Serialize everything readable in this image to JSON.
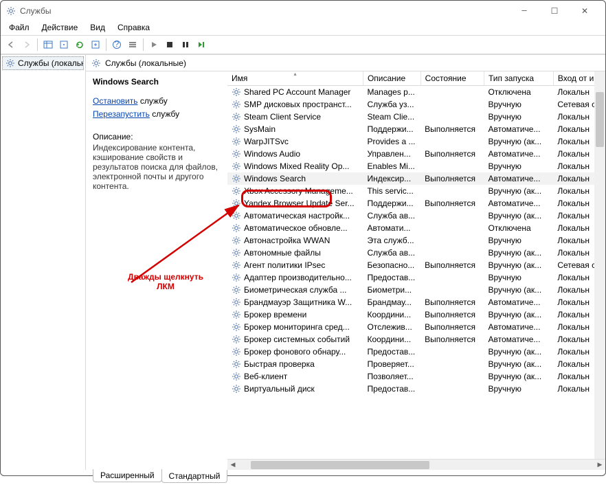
{
  "window": {
    "title": "Службы"
  },
  "menu": {
    "file": "Файл",
    "action": "Действие",
    "view": "Вид",
    "help": "Справка"
  },
  "tree": {
    "root": "Службы (локальн"
  },
  "main_head": "Службы (локальные)",
  "desc": {
    "name": "Windows Search",
    "stop_prefix": "Остановить",
    "stop_suffix": " службу",
    "restart_prefix": "Перезапустить",
    "restart_suffix": " службу",
    "heading": "Описание:",
    "text": "Индексирование контента, кэширование свойств и результатов поиска для файлов, электронной почты и другого контента."
  },
  "cols": {
    "name": "Имя",
    "desc": "Описание",
    "state": "Состояние",
    "start": "Тип запуска",
    "logon": "Вход от и"
  },
  "rows": [
    {
      "n": "Shared PC Account Manager",
      "d": "Manages p...",
      "s": "",
      "t": "Отключена",
      "l": "Локальн"
    },
    {
      "n": "SMP дисковых пространст...",
      "d": "Служба уз...",
      "s": "",
      "t": "Вручную",
      "l": "Сетевая с"
    },
    {
      "n": "Steam Client Service",
      "d": "Steam Clie...",
      "s": "",
      "t": "Вручную",
      "l": "Локальн"
    },
    {
      "n": "SysMain",
      "d": "Поддержи...",
      "s": "Выполняется",
      "t": "Автоматиче...",
      "l": "Локальн"
    },
    {
      "n": "WarpJITSvc",
      "d": "Provides a ...",
      "s": "",
      "t": "Вручную (ак...",
      "l": "Локальн"
    },
    {
      "n": "Windows Audio",
      "d": "Управлен...",
      "s": "Выполняется",
      "t": "Автоматиче...",
      "l": "Локальн"
    },
    {
      "n": "Windows Mixed Reality Op...",
      "d": "Enables Mi...",
      "s": "",
      "t": "Вручную",
      "l": "Локальн"
    },
    {
      "n": "Windows Search",
      "d": "Индексир...",
      "s": "Выполняется",
      "t": "Автоматиче...",
      "l": "Локальн",
      "sel": true
    },
    {
      "n": "Xbox Accessory Manageme...",
      "d": "This servic...",
      "s": "",
      "t": "Вручную (ак...",
      "l": "Локальн"
    },
    {
      "n": "Yandex.Browser Update Ser...",
      "d": "Поддержи...",
      "s": "Выполняется",
      "t": "Автоматиче...",
      "l": "Локальн"
    },
    {
      "n": "Автоматическая настройк...",
      "d": "Служба ав...",
      "s": "",
      "t": "Вручную (ак...",
      "l": "Локальн"
    },
    {
      "n": "Автоматическое обновле...",
      "d": "Автомати...",
      "s": "",
      "t": "Отключена",
      "l": "Локальн"
    },
    {
      "n": "Автонастройка WWAN",
      "d": "Эта служб...",
      "s": "",
      "t": "Вручную",
      "l": "Локальн"
    },
    {
      "n": "Автономные файлы",
      "d": "Служба ав...",
      "s": "",
      "t": "Вручную (ак...",
      "l": "Локальн"
    },
    {
      "n": "Агент политики IPsec",
      "d": "Безопасно...",
      "s": "Выполняется",
      "t": "Вручную (ак...",
      "l": "Сетевая с"
    },
    {
      "n": "Адаптер производительно...",
      "d": "Предостав...",
      "s": "",
      "t": "Вручную",
      "l": "Локальн"
    },
    {
      "n": "Биометрическая служба ...",
      "d": "Биометри...",
      "s": "",
      "t": "Вручную (ак...",
      "l": "Локальн"
    },
    {
      "n": "Брандмауэр Защитника W...",
      "d": "Брандмау...",
      "s": "Выполняется",
      "t": "Автоматиче...",
      "l": "Локальн"
    },
    {
      "n": "Брокер времени",
      "d": "Координи...",
      "s": "Выполняется",
      "t": "Вручную (ак...",
      "l": "Локальн"
    },
    {
      "n": "Брокер мониторинга сред...",
      "d": "Отслежив...",
      "s": "Выполняется",
      "t": "Автоматиче...",
      "l": "Локальн"
    },
    {
      "n": "Брокер системных событий",
      "d": "Координи...",
      "s": "Выполняется",
      "t": "Автоматиче...",
      "l": "Локальн"
    },
    {
      "n": "Брокер фонового обнару...",
      "d": "Предостав...",
      "s": "",
      "t": "Вручную (ак...",
      "l": "Локальн"
    },
    {
      "n": "Быстрая проверка",
      "d": "Проверяет...",
      "s": "",
      "t": "Вручную (ак...",
      "l": "Локальн"
    },
    {
      "n": "Веб-клиент",
      "d": "Позволяет...",
      "s": "",
      "t": "Вручную (ак...",
      "l": "Локальн"
    },
    {
      "n": "Виртуальный диск",
      "d": "Предостав...",
      "s": "",
      "t": "Вручную",
      "l": "Локальн"
    }
  ],
  "tabs": {
    "ext": "Расширенный",
    "std": "Стандартный"
  },
  "annot": {
    "text1": "Дважды щелкнуть",
    "text2": "ЛКМ"
  }
}
